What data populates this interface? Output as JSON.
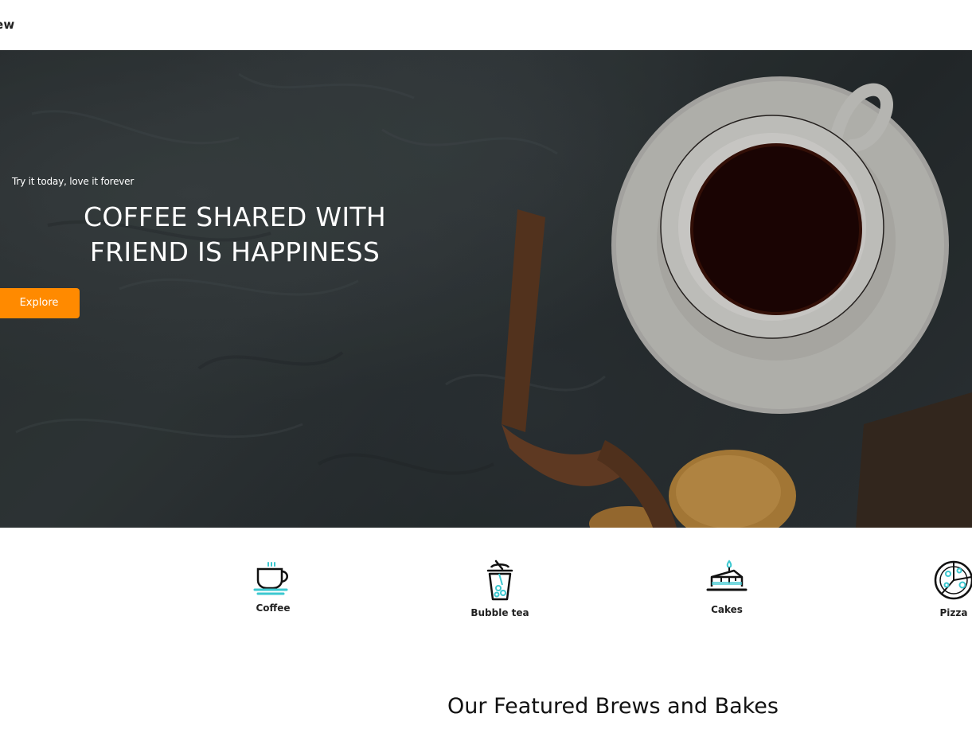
{
  "header": {
    "brand": "ew"
  },
  "hero": {
    "tagline": "Try it today, love it forever",
    "headline_lines": [
      "COFFEE SHARED WITH",
      "FRIEND IS HAPPINESS"
    ],
    "cta_label": "Explore"
  },
  "categories": [
    {
      "label": "Coffee",
      "icon": "coffee-cup-icon"
    },
    {
      "label": "Bubble tea",
      "icon": "bubble-tea-icon"
    },
    {
      "label": "Cakes",
      "icon": "cake-icon"
    },
    {
      "label": "Pizza",
      "icon": "pizza-icon"
    }
  ],
  "featured": {
    "title": "Our Featured Brews and Bakes"
  },
  "colors": {
    "accent": "#ff8a00",
    "icon_teal": "#3cc8d0",
    "hero_dark": "#2d3436"
  }
}
